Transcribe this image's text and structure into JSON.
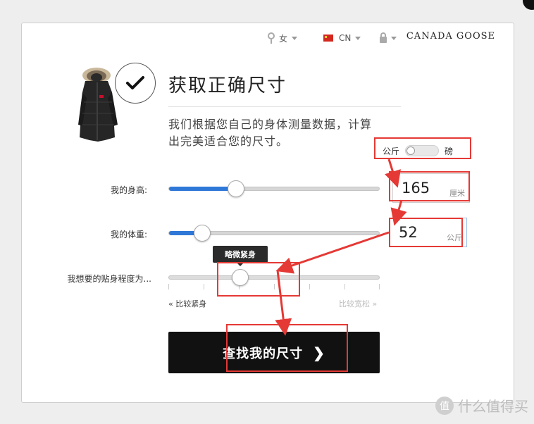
{
  "header": {
    "gender_label": "女",
    "country_label": "CN",
    "brand": "CANADA GOOSE"
  },
  "main": {
    "title": "获取正确尺寸",
    "description": "我们根据您自己的身体测量数据，计算出完美适合您的尺寸。"
  },
  "unit_toggle": {
    "metric_label": "公斤",
    "imperial_label": "磅"
  },
  "height": {
    "label": "我的身高:",
    "value": "165",
    "unit": "厘米",
    "slider_fraction": 0.32
  },
  "weight": {
    "label": "我的体重:",
    "value": "52",
    "unit": "公斤",
    "slider_fraction": 0.16
  },
  "fit": {
    "label": "我想要的贴身程度为...",
    "tooltip": "略微紧身",
    "slider_fraction": 0.34,
    "left_label": "« 比较紧身",
    "right_label": "比较宽松 »"
  },
  "cta": {
    "label": "查找我的尺寸",
    "chevron": "❯"
  },
  "watermark": {
    "badge": "值",
    "text": "什么值得买"
  },
  "colors": {
    "accent": "#2f78d8",
    "annotation": "#e53935",
    "cta_bg": "#111111"
  }
}
